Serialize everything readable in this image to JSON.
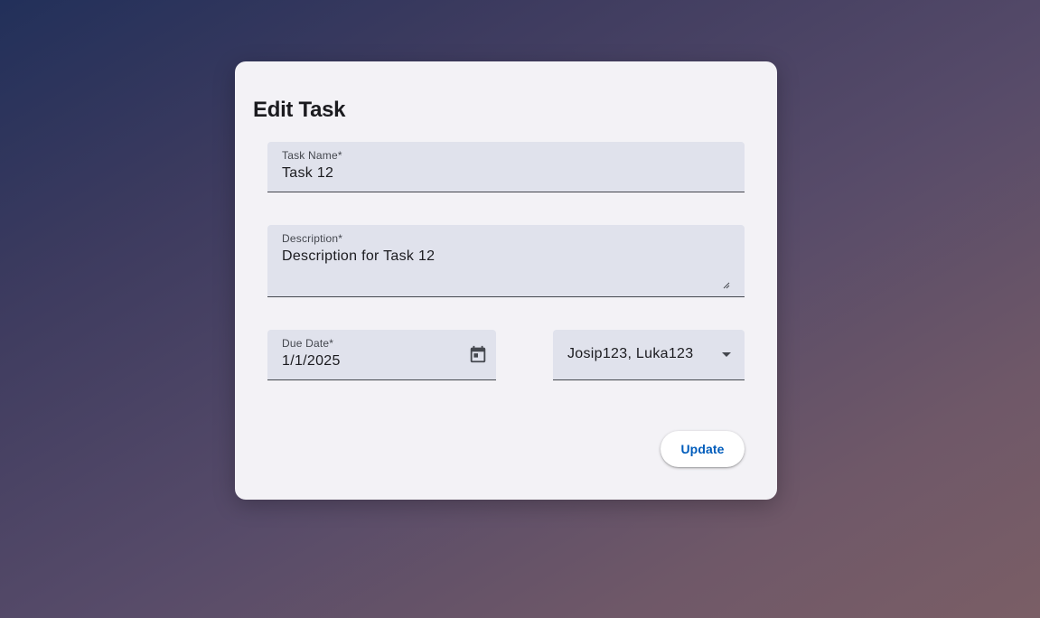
{
  "dialog": {
    "title": "Edit Task",
    "task_name": {
      "label": "Task Name*",
      "value": "Task 12"
    },
    "description": {
      "label": "Description*",
      "value": "Description for Task 12"
    },
    "due_date": {
      "label": "Due Date*",
      "value": "1/1/2025",
      "icon": "calendar-icon"
    },
    "assignees": {
      "value": "Josip123, Luka123",
      "icon": "dropdown-arrow-icon"
    },
    "update_label": "Update"
  },
  "colors": {
    "accent": "#005cbb",
    "field_bg": "#e0e2ec",
    "dialog_bg": "#f3f2f6"
  }
}
